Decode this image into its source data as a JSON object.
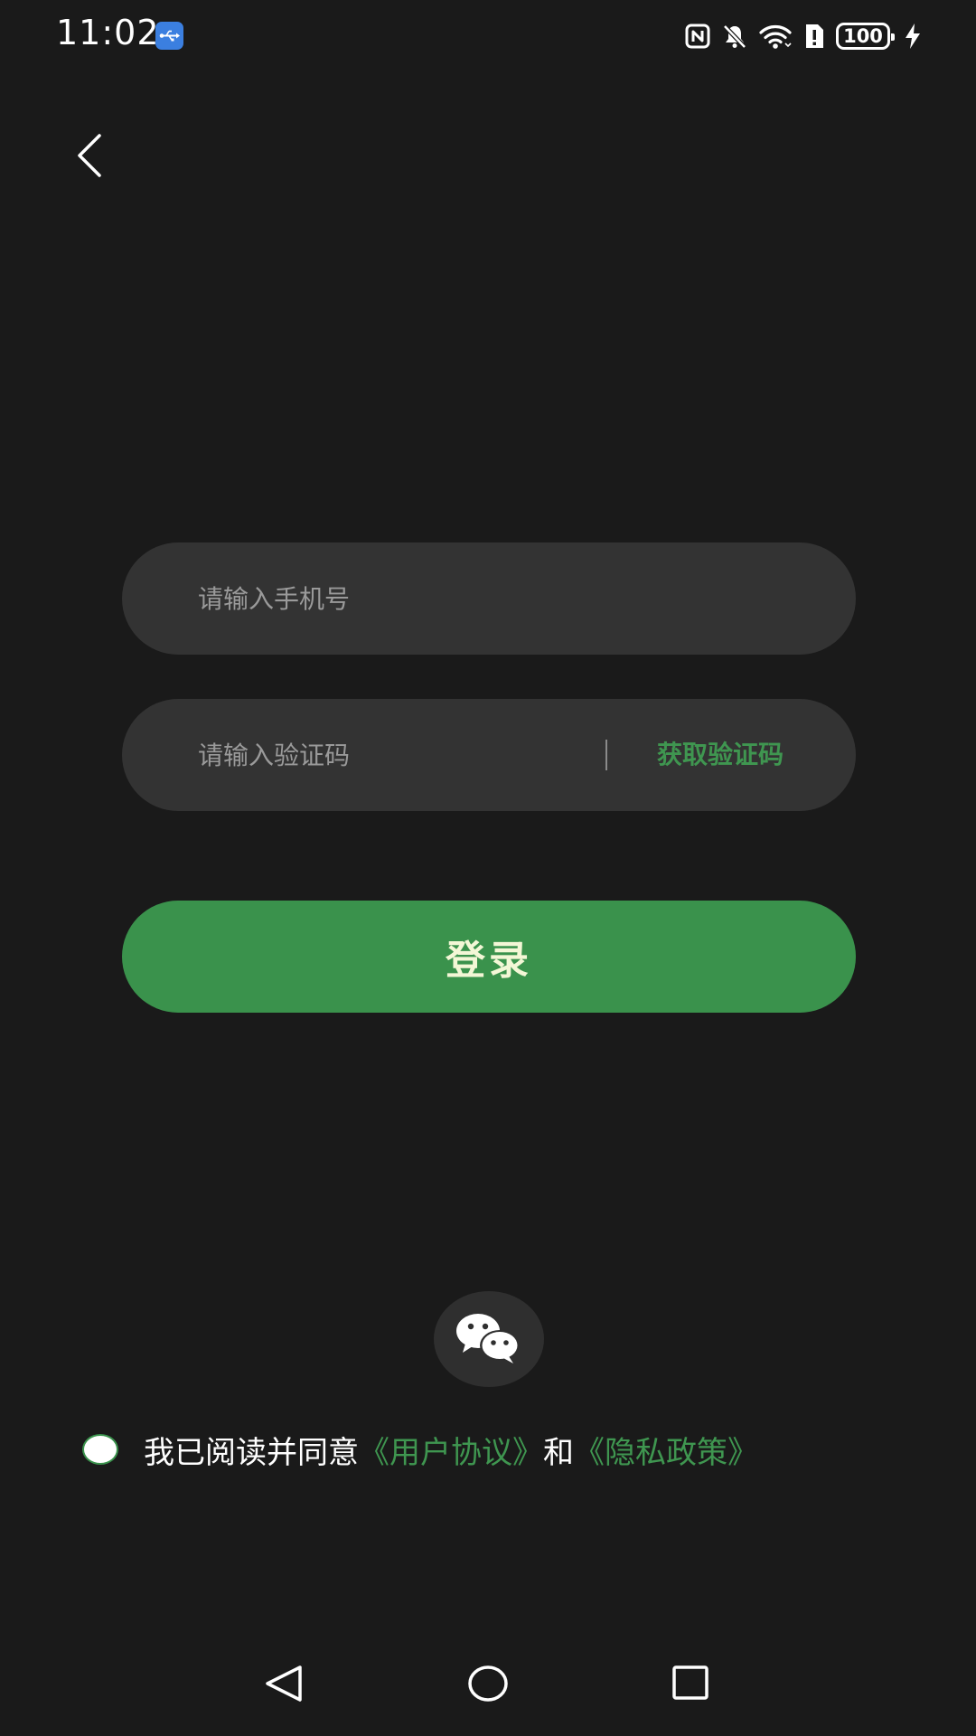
{
  "status_bar": {
    "time": "11:02",
    "battery": "100",
    "icons": [
      "usb-debug-icon",
      "nfc-icon",
      "bell-off-icon",
      "wifi-icon",
      "alert-icon",
      "battery-icon",
      "charging-icon"
    ]
  },
  "header": {
    "back_icon": "chevron-left-icon"
  },
  "login_form": {
    "phone_placeholder": "请输入手机号",
    "code_placeholder": "请输入验证码",
    "get_code_label": "获取验证码",
    "login_label": "登录"
  },
  "third_party": {
    "wechat_icon": "wechat-icon"
  },
  "agreement": {
    "prefix": "我已阅读并同意",
    "user_agreement": "《用户协议》",
    "conjunction": "和",
    "privacy_policy": "《隐私政策》"
  },
  "nav_bar": {
    "icons": [
      "nav-back-icon",
      "nav-home-icon",
      "nav-recents-icon"
    ]
  },
  "colors": {
    "background": "#1a1a1a",
    "input_background": "#333333",
    "accent_green": "#3a924c",
    "link_green": "#3f9650",
    "login_text": "#f3f7d6",
    "usb_badge": "#3b7fe0"
  }
}
